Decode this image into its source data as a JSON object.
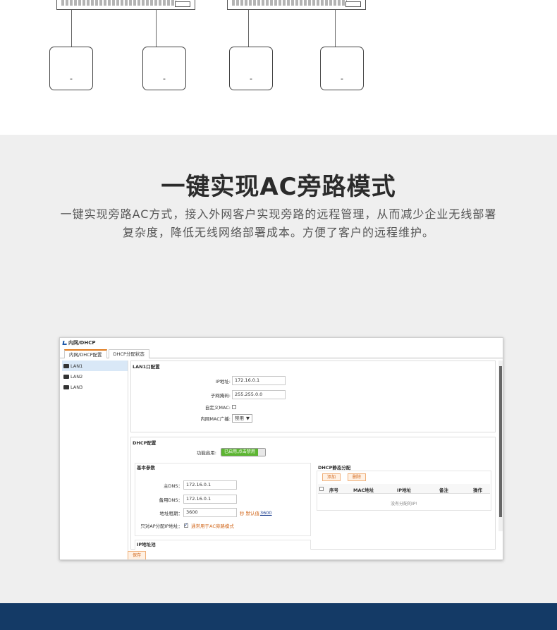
{
  "diagram": {
    "ap_labels": [
      "-",
      "-",
      "-",
      "-"
    ]
  },
  "feature": {
    "title": "一键实现AC旁路模式",
    "description": "一键实现旁路AC方式，接入外网客户实现旁路的远程管理，从而减少企业无线部署复杂度，降低无线网络部署成本。方便了客户的远程维护。"
  },
  "ui": {
    "breadcrumb": "内网/DHCP",
    "tabs": [
      "内网/DHCP配置",
      "DHCP分配状态"
    ],
    "sidebar": [
      "LAN1",
      "LAN2",
      "LAN3"
    ],
    "lan_config": {
      "title": "LAN1口配置",
      "ip_label": "IP地址:",
      "ip_value": "172.16.0.1",
      "mask_label": "子网掩码:",
      "mask_value": "255.255.0.0",
      "custom_mac_label": "自定义MAC:",
      "broadcast_label": "内网MAC广播:",
      "broadcast_value": "禁用",
      "broadcast_arrow": "▼"
    },
    "dhcp": {
      "title": "DHCP配置",
      "enable_label": "功能启用:",
      "enable_value": "已启用,点击禁用",
      "basic_title": "基本参数",
      "primary_dns_label": "主DNS：",
      "primary_dns_value": "172.16.0.1",
      "backup_dns_label": "备用DNS：",
      "backup_dns_value": "172.16.0.1",
      "lease_label": "地址租期：",
      "lease_value": "3600",
      "lease_unit": "秒",
      "lease_default_prefix": "默认值",
      "lease_default_value": "3600",
      "ap_only_label": "只对AP分配IP地址：",
      "ap_only_hint": "通常用于AC旁路模式",
      "pool_title": "IP地址池",
      "static_title": "DHCP静态分配",
      "add_button": "添加",
      "delete_button": "删除",
      "columns": [
        "序号",
        "MAC地址",
        "IP地址",
        "备注",
        "操作"
      ],
      "empty_text": "没有分配的IP!"
    },
    "save_button": "保存"
  }
}
